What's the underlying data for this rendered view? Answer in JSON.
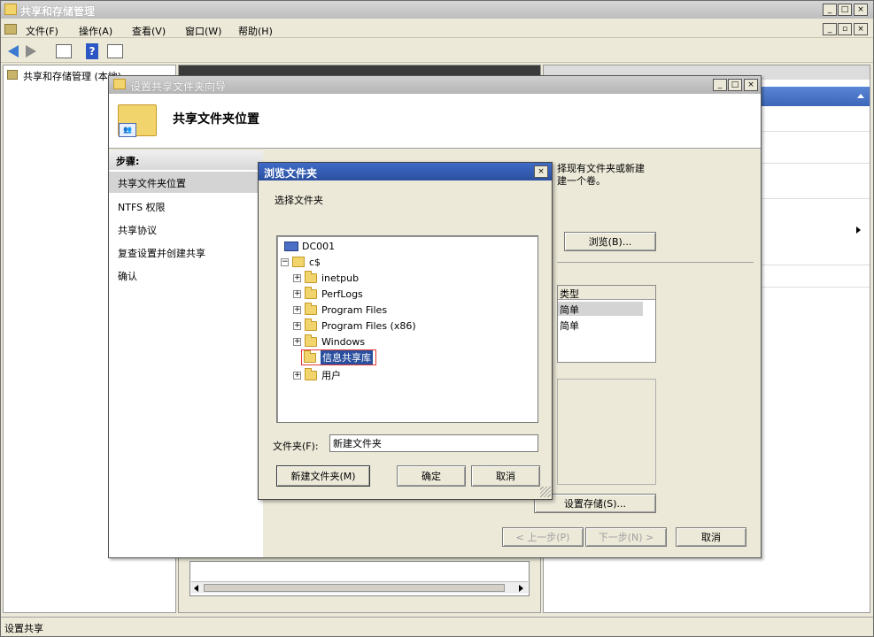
{
  "main_window": {
    "title": "共享和存储管理",
    "menu": [
      "文件(F)",
      "操作(A)",
      "查看(V)",
      "窗口(W)",
      "帮助(H)"
    ],
    "tree_root": "共享和存储管理 (本地)",
    "status_text": "设置共享"
  },
  "wizard": {
    "title": "设置共享文件夹向导",
    "header_title": "共享文件夹位置",
    "steps_label": "步骤:",
    "steps": [
      "共享文件夹位置",
      "NTFS 权限",
      "共享协议",
      "复查设置并创建共享",
      "确认"
    ],
    "desc_line1": "择现有文件夹或新建",
    "desc_line2": "建一个卷。",
    "browse_button": "浏览(B)...",
    "type_header": "类型",
    "type_rows": [
      "简单",
      "简单"
    ],
    "provision_button": "设置存储(S)...",
    "prev_button": "< 上一步(P)",
    "next_button": "下一步(N) >",
    "cancel_button": "取消"
  },
  "browse_dialog": {
    "title": "浏览文件夹",
    "close": "×",
    "prompt": "选择文件夹",
    "tree": {
      "computer": "DC001",
      "drive": "c$",
      "folders": [
        "inetpub",
        "PerfLogs",
        "Program Files",
        "Program Files (x86)",
        "Windows",
        "信息共享库",
        "用户"
      ]
    },
    "folder_label": "文件夹(F):",
    "folder_value": "新建文件夹",
    "new_folder_button": "新建文件夹(M)",
    "ok_button": "确定",
    "cancel_button": "取消"
  }
}
